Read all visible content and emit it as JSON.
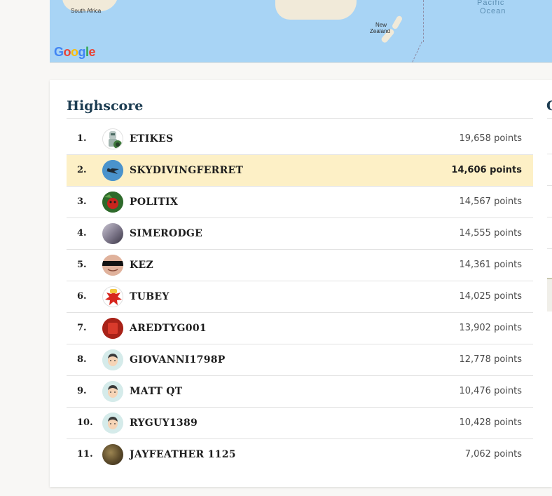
{
  "map": {
    "labels": {
      "south_africa": "South Africa",
      "new_zealand_1": "New",
      "new_zealand_2": "Zealand",
      "pacific_1": "Pacific",
      "pacific_2": "Ocean"
    },
    "logo": {
      "letters": [
        "G",
        "o",
        "o",
        "g",
        "l",
        "e"
      ],
      "colors": [
        "#4285F4",
        "#EA4335",
        "#FBBC05",
        "#4285F4",
        "#34A853",
        "#EA4335"
      ]
    },
    "ocean_color": "#a8d4f5",
    "land_color": "#f1ead9"
  },
  "highscore": {
    "title": "Highscore",
    "next_panel_title_partial": "C",
    "rows": [
      {
        "rank": "1.",
        "username": "ETIKES",
        "points": "19,658 points",
        "avatar": "robot-avatar",
        "highlighted": false
      },
      {
        "rank": "2.",
        "username": "SKYDIVINGFERRET",
        "points": "14,606 points",
        "avatar": "skydiver-avatar",
        "highlighted": true
      },
      {
        "rank": "3.",
        "username": "POLITIX",
        "points": "14,567 points",
        "avatar": "green-character-avatar",
        "highlighted": false
      },
      {
        "rank": "4.",
        "username": "SIMERODGE",
        "points": "14,555 points",
        "avatar": "photo-avatar",
        "highlighted": false
      },
      {
        "rank": "5.",
        "username": "KEZ",
        "points": "14,361 points",
        "avatar": "censored-face-avatar",
        "highlighted": false
      },
      {
        "rank": "6.",
        "username": "TUBEY",
        "points": "14,025 points",
        "avatar": "red-splat-avatar",
        "highlighted": false
      },
      {
        "rank": "7.",
        "username": "AREDTYG001",
        "points": "13,902 points",
        "avatar": "red-square-avatar",
        "highlighted": false
      },
      {
        "rank": "8.",
        "username": "GIOVANNI1798P",
        "points": "12,778 points",
        "avatar": "default-person-avatar",
        "highlighted": false
      },
      {
        "rank": "9.",
        "username": "MATT QT",
        "points": "10,476 points",
        "avatar": "default-person-avatar",
        "highlighted": false
      },
      {
        "rank": "10.",
        "username": "RYGUY1389",
        "points": "10,428 points",
        "avatar": "default-person-avatar",
        "highlighted": false
      },
      {
        "rank": "11.",
        "username": "JAYFEATHER 1125",
        "points": "7,062 points",
        "avatar": "landscape-avatar",
        "highlighted": false
      }
    ],
    "highlight_color": "#fdf0c6",
    "title_color": "#1d3d52"
  }
}
